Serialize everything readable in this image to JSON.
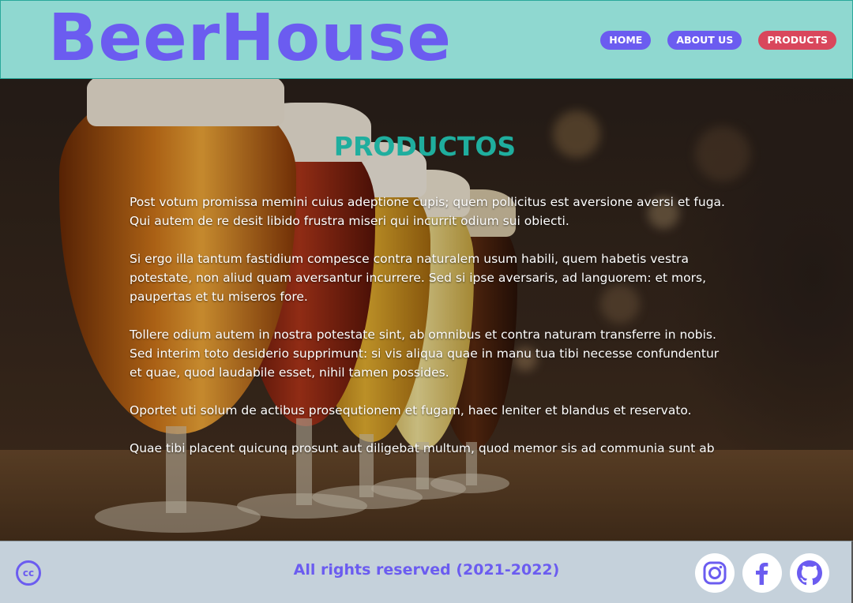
{
  "header": {
    "logo": "BeerHouse",
    "nav": [
      {
        "label": "HOME",
        "active": false
      },
      {
        "label": "ABOUT US",
        "active": false
      },
      {
        "label": "PRODUCTS",
        "active": true
      }
    ]
  },
  "main": {
    "title": "PRODUCTOS",
    "paragraphs": [
      "Post votum promissa memini cuius adeptione cupis; quem pollicitus est aversione aversi et fuga. Qui autem de re desit libido frustra miseri qui incurrit odium sui obiecti.",
      "Si ergo illa tantum fastidium compesce contra naturalem usum habili, quem habetis vestra potestate, non aliud quam aversantur incurrere. Sed si ipse aversaris, ad languorem: et mors, paupertas et tu miseros fore.",
      "Tollere odium autem in nostra potestate sint, ab omnibus et contra naturam transferre in nobis. Sed interim toto desiderio supprimunt: si vis aliqua quae in manu tua tibi necesse confundentur et quae, quod laudabile esset, nihil tamen possides.",
      "Oportet uti solum de actibus prosequtionem et fugam, haec leniter et blandus et reservato.",
      "Quae tibi placent quicunq prosunt aut diligebat multum, quod memor sis ad communia sunt ab"
    ]
  },
  "footer": {
    "cc_icon": "creative-commons-icon",
    "cc_text": "cc",
    "text": "All rights reserved (2021-2022)",
    "socials": [
      "instagram-icon",
      "facebook-icon",
      "github-icon"
    ]
  },
  "colors": {
    "header_bg": "#8fd8d0",
    "accent_purple": "#6b5cf0",
    "active_red": "#d9475c",
    "title_teal": "#1fae9e",
    "footer_bg": "#c5d1db"
  }
}
